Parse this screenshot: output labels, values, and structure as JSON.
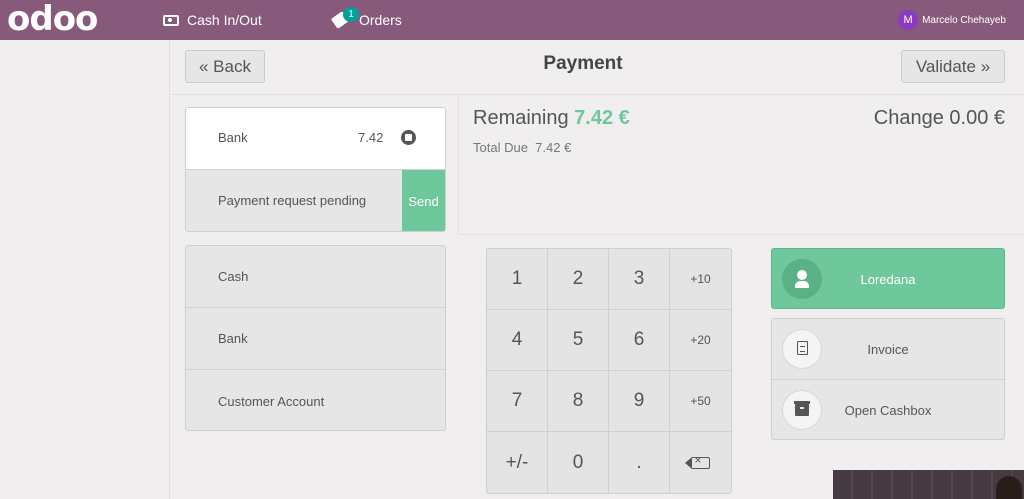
{
  "topbar": {
    "logo": "odoo",
    "cash_inout_label": "Cash In/Out",
    "orders_label": "Orders",
    "orders_badge": "1",
    "user_initial": "M",
    "user_name": "Marcelo Chehayeb",
    "bar_color": "#875a7b"
  },
  "header": {
    "back_label": "« Back",
    "title": "Payment",
    "validate_label": "Validate »"
  },
  "paymentlines": {
    "selected": {
      "name": "Bank",
      "amount": "7.42",
      "delete_icon": "delete-icon"
    },
    "pending_label": "Payment request pending",
    "send_label": "Send"
  },
  "payment_methods": [
    "Cash",
    "Bank",
    "Customer Account"
  ],
  "summary": {
    "remaining_label": "Remaining",
    "remaining_amount": "7.42 €",
    "change_label": "Change",
    "change_amount": "0.00 €",
    "total_due_label": "Total Due",
    "total_due_amount": "7.42 €",
    "accent_color": "#6ec89b"
  },
  "numpad": {
    "keys": [
      "1",
      "2",
      "3",
      "+10",
      "4",
      "5",
      "6",
      "+20",
      "7",
      "8",
      "9",
      "+50",
      "+/-",
      "0",
      ".",
      ""
    ]
  },
  "customer": {
    "name": "Loredana",
    "icon": "user-icon"
  },
  "actions": {
    "invoice_label": "Invoice",
    "cashbox_label": "Open Cashbox"
  }
}
